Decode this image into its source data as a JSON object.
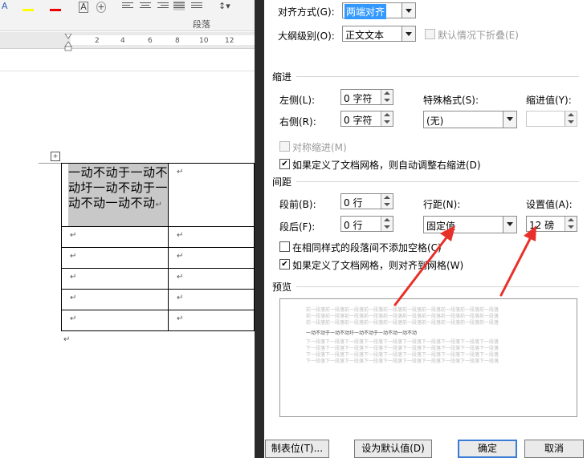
{
  "ribbon": {
    "group_label": "段落",
    "ruler_ticks": [
      "2",
      "4",
      "6",
      "8",
      "10",
      "12"
    ]
  },
  "document": {
    "first_cell_text": "一动不动于一动不动圩一动不动于一动不动一动不动",
    "anchor_glyph": "+",
    "paragraph_mark": "↵",
    "rows": 6
  },
  "dialog": {
    "alignment": {
      "label": "对齐方式(G):",
      "value": "两端对齐"
    },
    "outline": {
      "label": "大纲级别(O):",
      "value": "正文文本",
      "collapse_label": "默认情况下折叠(E)"
    },
    "indent": {
      "title": "缩进",
      "left_label": "左侧(L):",
      "left_value": "0 字符",
      "right_label": "右侧(R):",
      "right_value": "0 字符",
      "special_label": "特殊格式(S):",
      "special_value": "(无)",
      "by_label": "缩进值(Y):",
      "by_value": "",
      "mirror_label": "对称缩进(M)",
      "auto_adjust_label": "如果定义了文档网格，则自动调整右缩进(D)"
    },
    "spacing": {
      "title": "间距",
      "before_label": "段前(B):",
      "before_value": "0 行",
      "after_label": "段后(F):",
      "after_value": "0 行",
      "line_label": "行距(N):",
      "line_value": "固定值",
      "at_label": "设置值(A):",
      "at_value": "12 磅",
      "no_space_label": "在相同样式的段落间不添加空格(C)",
      "snap_grid_label": "如果定义了文档网格，则对齐到网格(W)"
    },
    "preview": {
      "title": "预览",
      "prev_text": "前一段落前一段落前一段落前一段落前一段落前一段落前一段落前一段落前一段落前一段落",
      "sample_text": "一动不动于一动不动圩一动不动于一动不动一动不动",
      "next_text": "下一段落下一段落下一段落下一段落下一段落下一段落下一段落下一段落下一段落下一段落"
    },
    "buttons": {
      "tabs": "制表位(T)...",
      "set_default": "设为默认值(D)",
      "ok": "确定",
      "cancel": "取消"
    }
  },
  "colors": {
    "selection_blue": "#3399ff",
    "annotation_red": "#e8302a"
  }
}
